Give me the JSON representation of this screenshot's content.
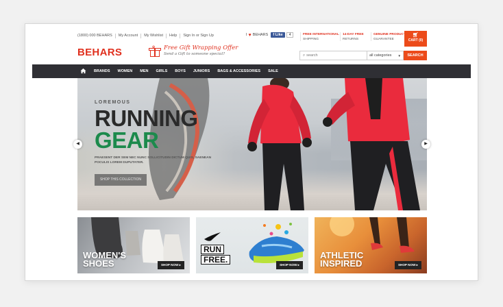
{
  "utility_links": [
    "(1800) 000 BEHARS",
    "My Account",
    "My Wishlist",
    "Help",
    "Sign In or Sign Up"
  ],
  "social": {
    "prefix": "I",
    "brand": "BEHARS",
    "fb_like": "Like",
    "fb_count": "4"
  },
  "promos": [
    {
      "line1": "FREE INTERNATIONAL",
      "line2": "SHIPPING"
    },
    {
      "line1": "14-DAY FREE",
      "line2": "RETURNS"
    },
    {
      "line1": "GENUINE PRODUCT",
      "line2": "GUARANTEE"
    }
  ],
  "cart": {
    "label": "CART (0)"
  },
  "logo": "BEHARS",
  "offer": {
    "line1": "Free Gift Wrapping Offer",
    "line2": "Send a Gift to someone special?"
  },
  "search": {
    "placeholder": "search",
    "category": "all categories",
    "button": "SEARCH"
  },
  "nav": [
    "BRANDS",
    "WOMEN",
    "MEN",
    "GIRLS",
    "BOYS",
    "JUNIORS",
    "BAGS & ACCESSORIES",
    "SALE"
  ],
  "hero": {
    "kicker": "LOREMOUS",
    "title1": "RUNNING",
    "title2": "GEAR",
    "desc": "PRAESENT DER SEM NEC NUNC SOLLICITUDIN DICTUM QUIS, SAENEAN POCULIS LOREM DUPUTATER.",
    "button": "SHOP THIS COLLECTION"
  },
  "tiles": [
    {
      "title": "WOMEN'S\nSHOES",
      "cta": "SHOP NOW ▸"
    },
    {
      "title1": "RUN",
      "title2": "FREE.",
      "cta": "SHOP NOW ▸"
    },
    {
      "title": "ATHLETIC\nINSPIRED",
      "cta": "SHOP NOW ▸"
    }
  ],
  "colors": {
    "brand": "#e0301e",
    "accent": "#ec4b1a",
    "nav": "#2f2f34",
    "hero_green": "#1c8a4c"
  }
}
